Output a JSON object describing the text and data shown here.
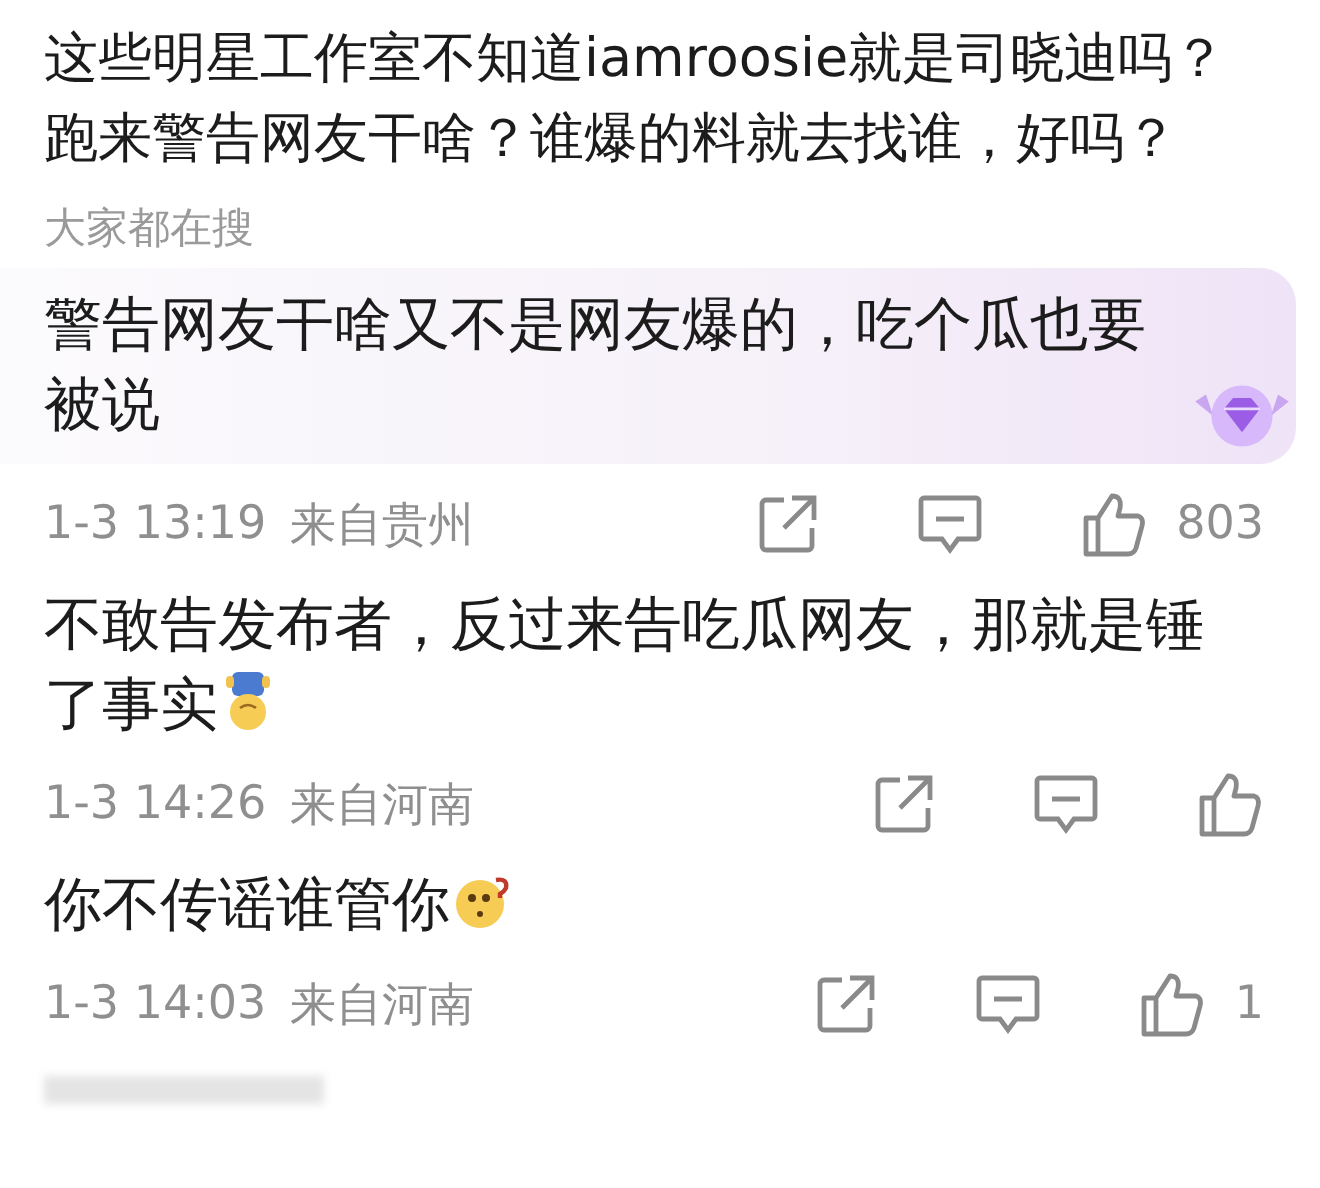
{
  "post": {
    "text": "这些明星工作室不知道iamroosie就是司晓迪吗？跑来警告网友干啥？谁爆的料就去找谁，好吗？",
    "hot_search": {
      "label": "大家都在搜",
      "text": "警告网友干啥又不是网友爆的，吃个瓜也要被说"
    },
    "meta": {
      "time": "1-3 13:19",
      "location": "来自贵州",
      "likes": "803"
    }
  },
  "replies": [
    {
      "text": "不敢告发布者，反过来告吃瓜网友，那就是锤了事实",
      "emoji": {
        "kind": "upside-down"
      },
      "meta": {
        "time": "1-3 14:26",
        "location": "来自河南"
      }
    },
    {
      "text": "你不传谣谁管你",
      "emoji": {
        "kind": "puzzled"
      },
      "meta": {
        "time": "1-3 14:03",
        "location": "来自河南",
        "likes": "1"
      }
    }
  ]
}
